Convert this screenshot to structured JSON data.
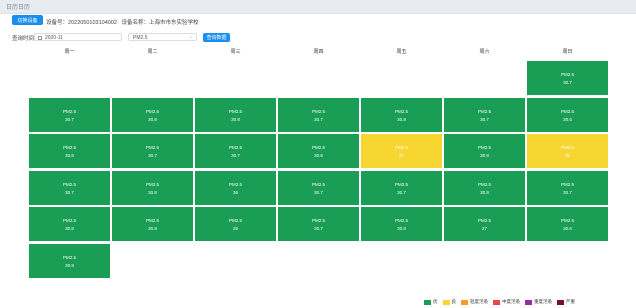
{
  "window": {
    "title": "日历日历"
  },
  "toolbar": {
    "switch_label": "切换设备",
    "device_no_label": "设备号：",
    "device_no": "2022050103104002",
    "device_name_label": "设备名称：",
    "device_name": "上海市市东实验学校"
  },
  "query": {
    "label": "查询时间",
    "date_value": "2020-11",
    "pollutant_value": "PM2.5",
    "query_button": "查询数据"
  },
  "weekdays": [
    "周一",
    "周二",
    "周三",
    "周四",
    "周五",
    "周六",
    "周日"
  ],
  "calendar": {
    "rows": [
      [
        null,
        null,
        null,
        null,
        null,
        null,
        {
          "name": "PM2.5",
          "value": "30.7",
          "level": "good"
        }
      ],
      [
        {
          "name": "PM2.5",
          "value": "30.7",
          "level": "good"
        },
        {
          "name": "PM2.5",
          "value": "30.8",
          "level": "good"
        },
        {
          "name": "PM2.5",
          "value": "30.8",
          "level": "good"
        },
        {
          "name": "PM2.5",
          "value": "30.7",
          "level": "good"
        },
        {
          "name": "PM2.5",
          "value": "30.8",
          "level": "good"
        },
        {
          "name": "PM2.5",
          "value": "30.7",
          "level": "good"
        },
        {
          "name": "PM2.5",
          "value": "30.6",
          "level": "good"
        }
      ],
      [
        {
          "name": "PM2.5",
          "value": "30.8",
          "level": "good"
        },
        {
          "name": "PM2.5",
          "value": "30.7",
          "level": "good"
        },
        {
          "name": "PM2.5",
          "value": "30.7",
          "level": "good"
        },
        {
          "name": "PM2.5",
          "value": "30.6",
          "level": "good"
        },
        {
          "name": "PM2.5",
          "value": "37",
          "level": "moderate"
        },
        {
          "name": "PM2.5",
          "value": "30.8",
          "level": "good"
        },
        {
          "name": "PM2.5",
          "value": "35",
          "level": "moderate"
        }
      ],
      [
        {
          "name": "PM2.5",
          "value": "30.7",
          "level": "good"
        },
        {
          "name": "PM2.5",
          "value": "30.8",
          "level": "good"
        },
        {
          "name": "PM2.5",
          "value": "36",
          "level": "good"
        },
        {
          "name": "PM2.5",
          "value": "30.7",
          "level": "good"
        },
        {
          "name": "PM2.5",
          "value": "30.7",
          "level": "good"
        },
        {
          "name": "PM2.5",
          "value": "30.8",
          "level": "good"
        },
        {
          "name": "PM2.5",
          "value": "30.7",
          "level": "good"
        }
      ],
      [
        {
          "name": "PM2.5",
          "value": "30.8",
          "level": "good"
        },
        {
          "name": "PM2.5",
          "value": "30.8",
          "level": "good"
        },
        {
          "name": "PM2.5",
          "value": "26",
          "level": "good"
        },
        {
          "name": "PM2.5",
          "value": "30.7",
          "level": "good"
        },
        {
          "name": "PM2.5",
          "value": "30.8",
          "level": "good"
        },
        {
          "name": "PM2.5",
          "value": "27",
          "level": "good"
        },
        {
          "name": "PM2.5",
          "value": "30.6",
          "level": "good"
        }
      ],
      [
        {
          "name": "PM2.5",
          "value": "30.8",
          "level": "good"
        },
        null,
        null,
        null,
        null,
        null,
        null
      ]
    ]
  },
  "legend": [
    {
      "label": "优",
      "color": "#1a9e55"
    },
    {
      "label": "良",
      "color": "#f7d631"
    },
    {
      "label": "轻度污染",
      "color": "#f39a2b"
    },
    {
      "label": "中度污染",
      "color": "#e5484d"
    },
    {
      "label": "重度污染",
      "color": "#9b2aa8"
    },
    {
      "label": "严重",
      "color": "#7a1020"
    }
  ],
  "colors": {
    "good": "#1a9e55",
    "moderate": "#f7d631",
    "accent": "#1a8ef0"
  }
}
